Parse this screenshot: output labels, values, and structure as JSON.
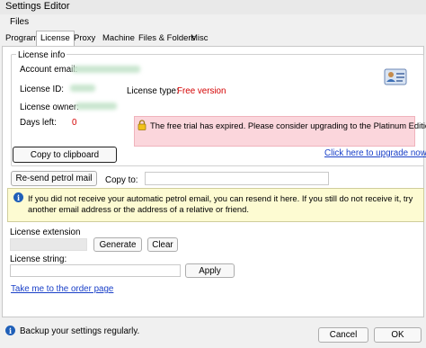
{
  "window": {
    "title": "Settings Editor"
  },
  "menu": {
    "files": "Files"
  },
  "tabs": [
    "Program",
    "License",
    "Proxy",
    "Machine",
    "Files & Folders",
    "Misc"
  ],
  "license_info": {
    "group_title": "License info",
    "account_email_label": "Account email:",
    "license_id_label": "License ID:",
    "license_owner_label": "License owner:",
    "days_left_label": "Days left:",
    "days_left_value": "0",
    "license_type_label": "License type:",
    "license_type_value": "Free version",
    "copy_button": "Copy to clipboard",
    "warning_text": "The free trial has expired. Please consider upgrading to the Platinum Edition.",
    "upgrade_link": "Click here to upgrade now"
  },
  "resend": {
    "button": "Re-send petrol mail",
    "copy_to_label": "Copy to:",
    "copy_to_value": ""
  },
  "info_text": "If you did not receive your automatic petrol email, you can resend it here. If you still do not receive it, try another email address or the address of a relative or friend.",
  "license_extension": {
    "label": "License extension",
    "value": "",
    "generate_button": "Generate",
    "clear_button": "Clear"
  },
  "license_string": {
    "label": "License string:",
    "value": "",
    "apply_button": "Apply"
  },
  "order_link": "Take me to the order page",
  "status": {
    "text": "Backup your settings regularly.",
    "cancel_button": "Cancel",
    "ok_button": "OK"
  },
  "colors": {
    "red_text": "#d40000",
    "link": "#1a40c8",
    "warning_bg": "#fbd6dc",
    "info_bg": "#fdfbd2"
  },
  "icons": [
    "info-icon",
    "lock-icon",
    "contact-card-icon"
  ]
}
